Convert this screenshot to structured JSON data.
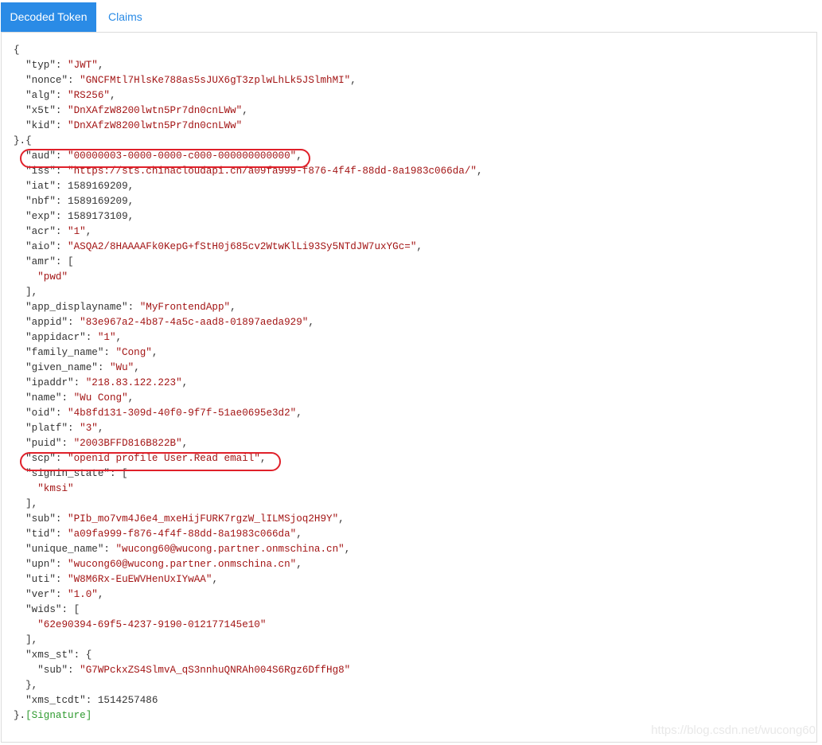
{
  "tabs": [
    {
      "label": "Decoded Token",
      "active": true
    },
    {
      "label": "Claims",
      "active": false
    }
  ],
  "code_lines": [
    [
      [
        "p",
        "{"
      ]
    ],
    [
      [
        "p",
        "  "
      ],
      [
        "k",
        "\"typ\""
      ],
      [
        "p",
        ": "
      ],
      [
        "s",
        "\"JWT\""
      ],
      [
        "p",
        ","
      ]
    ],
    [
      [
        "p",
        "  "
      ],
      [
        "k",
        "\"nonce\""
      ],
      [
        "p",
        ": "
      ],
      [
        "s",
        "\"GNCFMtl7HlsKe788as5sJUX6gT3zplwLhLk5JSlmhMI\""
      ],
      [
        "p",
        ","
      ]
    ],
    [
      [
        "p",
        "  "
      ],
      [
        "k",
        "\"alg\""
      ],
      [
        "p",
        ": "
      ],
      [
        "s",
        "\"RS256\""
      ],
      [
        "p",
        ","
      ]
    ],
    [
      [
        "p",
        "  "
      ],
      [
        "k",
        "\"x5t\""
      ],
      [
        "p",
        ": "
      ],
      [
        "s",
        "\"DnXAfzW8200lwtn5Pr7dn0cnLWw\""
      ],
      [
        "p",
        ","
      ]
    ],
    [
      [
        "p",
        "  "
      ],
      [
        "k",
        "\"kid\""
      ],
      [
        "p",
        ": "
      ],
      [
        "s",
        "\"DnXAfzW8200lwtn5Pr7dn0cnLWw\""
      ]
    ],
    [
      [
        "p",
        "}.{"
      ]
    ],
    [
      [
        "p",
        "  "
      ],
      [
        "k",
        "\"aud\""
      ],
      [
        "p",
        ": "
      ],
      [
        "s",
        "\"00000003-0000-0000-c000-000000000000\""
      ],
      [
        "p",
        ","
      ]
    ],
    [
      [
        "p",
        "  "
      ],
      [
        "k",
        "\"iss\""
      ],
      [
        "p",
        ": "
      ],
      [
        "s",
        "\"https://sts.chinacloudapi.cn/a09fa999-f876-4f4f-88dd-8a1983c066da/\""
      ],
      [
        "p",
        ","
      ]
    ],
    [
      [
        "p",
        "  "
      ],
      [
        "k",
        "\"iat\""
      ],
      [
        "p",
        ": "
      ],
      [
        "n",
        "1589169209"
      ],
      [
        "p",
        ","
      ]
    ],
    [
      [
        "p",
        "  "
      ],
      [
        "k",
        "\"nbf\""
      ],
      [
        "p",
        ": "
      ],
      [
        "n",
        "1589169209"
      ],
      [
        "p",
        ","
      ]
    ],
    [
      [
        "p",
        "  "
      ],
      [
        "k",
        "\"exp\""
      ],
      [
        "p",
        ": "
      ],
      [
        "n",
        "1589173109"
      ],
      [
        "p",
        ","
      ]
    ],
    [
      [
        "p",
        "  "
      ],
      [
        "k",
        "\"acr\""
      ],
      [
        "p",
        ": "
      ],
      [
        "s",
        "\"1\""
      ],
      [
        "p",
        ","
      ]
    ],
    [
      [
        "p",
        "  "
      ],
      [
        "k",
        "\"aio\""
      ],
      [
        "p",
        ": "
      ],
      [
        "s",
        "\"ASQA2/8HAAAAFk0KepG+fStH0j685cv2WtwKlLi93Sy5NTdJW7uxYGc=\""
      ],
      [
        "p",
        ","
      ]
    ],
    [
      [
        "p",
        "  "
      ],
      [
        "k",
        "\"amr\""
      ],
      [
        "p",
        ": ["
      ]
    ],
    [
      [
        "p",
        "    "
      ],
      [
        "s",
        "\"pwd\""
      ]
    ],
    [
      [
        "p",
        "  ],"
      ]
    ],
    [
      [
        "p",
        "  "
      ],
      [
        "k",
        "\"app_displayname\""
      ],
      [
        "p",
        ": "
      ],
      [
        "s",
        "\"MyFrontendApp\""
      ],
      [
        "p",
        ","
      ]
    ],
    [
      [
        "p",
        "  "
      ],
      [
        "k",
        "\"appid\""
      ],
      [
        "p",
        ": "
      ],
      [
        "s",
        "\"83e967a2-4b87-4a5c-aad8-01897aeda929\""
      ],
      [
        "p",
        ","
      ]
    ],
    [
      [
        "p",
        "  "
      ],
      [
        "k",
        "\"appidacr\""
      ],
      [
        "p",
        ": "
      ],
      [
        "s",
        "\"1\""
      ],
      [
        "p",
        ","
      ]
    ],
    [
      [
        "p",
        "  "
      ],
      [
        "k",
        "\"family_name\""
      ],
      [
        "p",
        ": "
      ],
      [
        "s",
        "\"Cong\""
      ],
      [
        "p",
        ","
      ]
    ],
    [
      [
        "p",
        "  "
      ],
      [
        "k",
        "\"given_name\""
      ],
      [
        "p",
        ": "
      ],
      [
        "s",
        "\"Wu\""
      ],
      [
        "p",
        ","
      ]
    ],
    [
      [
        "p",
        "  "
      ],
      [
        "k",
        "\"ipaddr\""
      ],
      [
        "p",
        ": "
      ],
      [
        "s",
        "\"218.83.122.223\""
      ],
      [
        "p",
        ","
      ]
    ],
    [
      [
        "p",
        "  "
      ],
      [
        "k",
        "\"name\""
      ],
      [
        "p",
        ": "
      ],
      [
        "s",
        "\"Wu Cong\""
      ],
      [
        "p",
        ","
      ]
    ],
    [
      [
        "p",
        "  "
      ],
      [
        "k",
        "\"oid\""
      ],
      [
        "p",
        ": "
      ],
      [
        "s",
        "\"4b8fd131-309d-40f0-9f7f-51ae0695e3d2\""
      ],
      [
        "p",
        ","
      ]
    ],
    [
      [
        "p",
        "  "
      ],
      [
        "k",
        "\"platf\""
      ],
      [
        "p",
        ": "
      ],
      [
        "s",
        "\"3\""
      ],
      [
        "p",
        ","
      ]
    ],
    [
      [
        "p",
        "  "
      ],
      [
        "k",
        "\"puid\""
      ],
      [
        "p",
        ": "
      ],
      [
        "s",
        "\"2003BFFD816B822B\""
      ],
      [
        "p",
        ","
      ]
    ],
    [
      [
        "p",
        "  "
      ],
      [
        "k",
        "\"scp\""
      ],
      [
        "p",
        ": "
      ],
      [
        "s",
        "\"openid profile User.Read email\""
      ],
      [
        "p",
        ","
      ]
    ],
    [
      [
        "p",
        "  "
      ],
      [
        "k",
        "\"signin_state\""
      ],
      [
        "p",
        ": ["
      ]
    ],
    [
      [
        "p",
        "    "
      ],
      [
        "s",
        "\"kmsi\""
      ]
    ],
    [
      [
        "p",
        "  ],"
      ]
    ],
    [
      [
        "p",
        "  "
      ],
      [
        "k",
        "\"sub\""
      ],
      [
        "p",
        ": "
      ],
      [
        "s",
        "\"PIb_mo7vm4J6e4_mxeHijFURK7rgzW_lILMSjoq2H9Y\""
      ],
      [
        "p",
        ","
      ]
    ],
    [
      [
        "p",
        "  "
      ],
      [
        "k",
        "\"tid\""
      ],
      [
        "p",
        ": "
      ],
      [
        "s",
        "\"a09fa999-f876-4f4f-88dd-8a1983c066da\""
      ],
      [
        "p",
        ","
      ]
    ],
    [
      [
        "p",
        "  "
      ],
      [
        "k",
        "\"unique_name\""
      ],
      [
        "p",
        ": "
      ],
      [
        "s",
        "\"wucong60@wucong.partner.onmschina.cn\""
      ],
      [
        "p",
        ","
      ]
    ],
    [
      [
        "p",
        "  "
      ],
      [
        "k",
        "\"upn\""
      ],
      [
        "p",
        ": "
      ],
      [
        "s",
        "\"wucong60@wucong.partner.onmschina.cn\""
      ],
      [
        "p",
        ","
      ]
    ],
    [
      [
        "p",
        "  "
      ],
      [
        "k",
        "\"uti\""
      ],
      [
        "p",
        ": "
      ],
      [
        "s",
        "\"W8M6Rx-EuEWVHenUxIYwAA\""
      ],
      [
        "p",
        ","
      ]
    ],
    [
      [
        "p",
        "  "
      ],
      [
        "k",
        "\"ver\""
      ],
      [
        "p",
        ": "
      ],
      [
        "s",
        "\"1.0\""
      ],
      [
        "p",
        ","
      ]
    ],
    [
      [
        "p",
        "  "
      ],
      [
        "k",
        "\"wids\""
      ],
      [
        "p",
        ": ["
      ]
    ],
    [
      [
        "p",
        "    "
      ],
      [
        "s",
        "\"62e90394-69f5-4237-9190-012177145e10\""
      ]
    ],
    [
      [
        "p",
        "  ],"
      ]
    ],
    [
      [
        "p",
        "  "
      ],
      [
        "k",
        "\"xms_st\""
      ],
      [
        "p",
        ": {"
      ]
    ],
    [
      [
        "p",
        "    "
      ],
      [
        "k",
        "\"sub\""
      ],
      [
        "p",
        ": "
      ],
      [
        "s",
        "\"G7WPckxZS4SlmvA_qS3nnhuQNRAh004S6Rgz6DffHg8\""
      ]
    ],
    [
      [
        "p",
        "  },"
      ]
    ],
    [
      [
        "p",
        "  "
      ],
      [
        "k",
        "\"xms_tcdt\""
      ],
      [
        "p",
        ": "
      ],
      [
        "n",
        "1514257486"
      ]
    ],
    [
      [
        "p",
        "}."
      ],
      [
        "sig",
        "[Signature]"
      ]
    ]
  ],
  "watermark": "https://blog.csdn.net/wucong60",
  "colors": {
    "tab_active_bg": "#2a8be6",
    "string": "#a31515",
    "signature": "#2e9a2e",
    "highlight": "#e0202a"
  }
}
